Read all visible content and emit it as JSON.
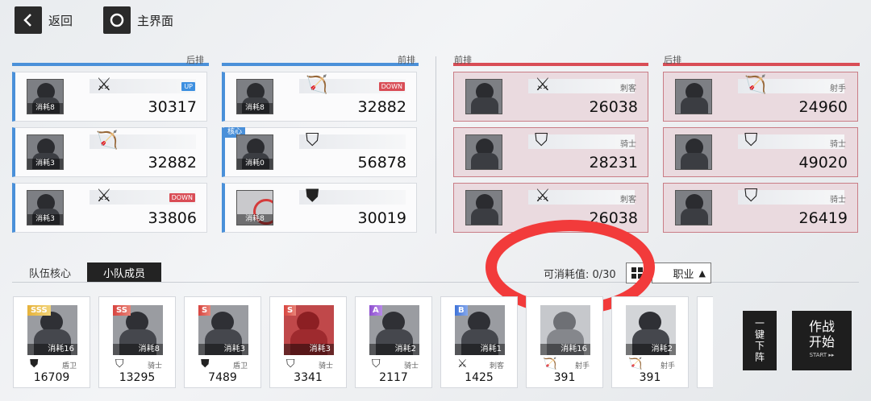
{
  "nav": {
    "back_label": "返回",
    "home_label": "主界面"
  },
  "zones": {
    "left_back": "后排",
    "left_front": "前排",
    "right_front": "前排",
    "right_back": "后排"
  },
  "left_back": [
    {
      "cost": "消耗8",
      "role_icon": "swords-icon",
      "power": "30317",
      "badge": "UP",
      "badge_type": "up"
    },
    {
      "cost": "消耗3",
      "role_icon": "bow-icon",
      "power": "32882"
    },
    {
      "cost": "消耗3",
      "role_icon": "swords-icon",
      "power": "33806",
      "badge": "DOWN",
      "badge_type": "down"
    }
  ],
  "left_front": [
    {
      "cost": "消耗8",
      "role_icon": "bow-icon",
      "power": "32882",
      "badge": "DOWN",
      "badge_type": "down"
    },
    {
      "cost": "消耗0",
      "role_icon": "shield-slash-icon",
      "power": "56878",
      "core": "核心"
    },
    {
      "cost": "消耗8",
      "role_icon": "shield-icon",
      "power": "30019"
    }
  ],
  "right_front": [
    {
      "role_icon": "swords-icon",
      "role": "刺客",
      "power": "26038"
    },
    {
      "role_icon": "shield-slash-icon",
      "role": "骑士",
      "power": "28231"
    },
    {
      "role_icon": "swords-icon",
      "role": "刺客",
      "power": "26038"
    }
  ],
  "right_back": [
    {
      "role_icon": "bow-icon",
      "role": "射手",
      "power": "24960"
    },
    {
      "role_icon": "shield-slash-icon",
      "role": "骑士",
      "power": "49020"
    },
    {
      "role_icon": "shield-slash-icon",
      "role": "骑士",
      "power": "26419"
    }
  ],
  "tabs": {
    "core": "队伍核心",
    "members": "小队成员"
  },
  "cost_label": "可消耗值: 0/30",
  "filter_label": "职业",
  "units": [
    {
      "rank": "SSS",
      "cost": "消耗16",
      "role_icon": "shield-icon",
      "role": "盾卫",
      "power": "16709"
    },
    {
      "rank": "SS",
      "cost": "消耗8",
      "role_icon": "shield-slash-icon",
      "role": "骑士",
      "power": "13295"
    },
    {
      "rank": "S",
      "cost": "消耗3",
      "role_icon": "shield-icon",
      "role": "盾卫",
      "power": "7489"
    },
    {
      "rank": "S",
      "cost": "消耗3",
      "role_icon": "shield-slash-icon",
      "role": "骑士",
      "power": "3341"
    },
    {
      "rank": "A",
      "cost": "消耗2",
      "role_icon": "shield-slash-icon",
      "role": "骑士",
      "power": "2117"
    },
    {
      "rank": "B",
      "cost": "消耗1",
      "role_icon": "swords-icon",
      "role": "刺客",
      "power": "1425"
    },
    {
      "rank": "",
      "cost": "消耗16",
      "role_icon": "bow-icon",
      "role": "射手",
      "power": "391"
    },
    {
      "rank": "",
      "cost": "消耗2",
      "role_icon": "bow-icon",
      "role": "射手",
      "power": "391"
    }
  ],
  "quick_remove_label": "一键下阵",
  "start": {
    "label_1": "作战",
    "label_2": "开始",
    "sub": "START ▸▸"
  },
  "colors": {
    "ally": "#4a90d9",
    "enemy": "#d94d56",
    "annotation": "#f23b3b"
  }
}
